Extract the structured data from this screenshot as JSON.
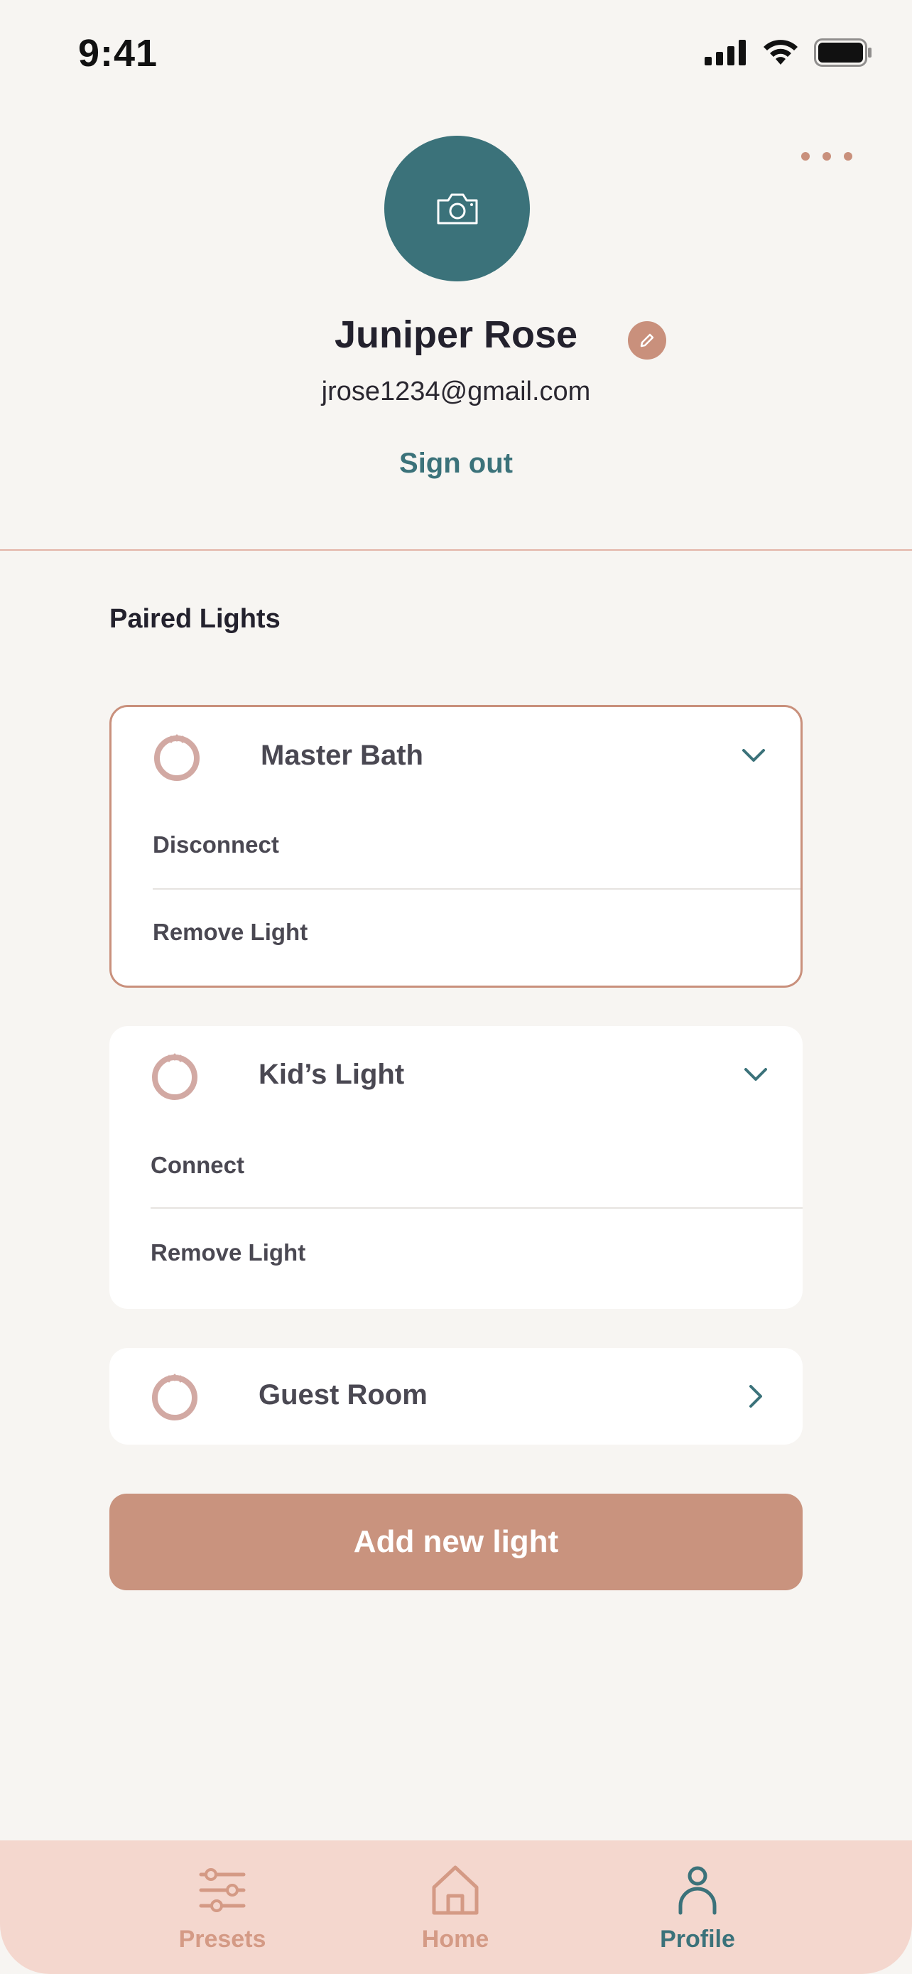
{
  "status_bar": {
    "time": "9:41"
  },
  "profile": {
    "name": "Juniper Rose",
    "email": "jrose1234@gmail.com",
    "sign_out_label": "Sign out"
  },
  "section": {
    "title": "Paired Lights"
  },
  "lights": [
    {
      "name": "Master Bath",
      "expanded": true,
      "actions": [
        "Disconnect",
        "Remove Light"
      ]
    },
    {
      "name": "Kid’s Light",
      "expanded": true,
      "actions": [
        "Connect",
        "Remove Light"
      ]
    },
    {
      "name": "Guest Room",
      "expanded": false,
      "actions": []
    }
  ],
  "add_button_label": "Add new light",
  "tabs": [
    {
      "label": "Presets",
      "icon": "sliders-icon",
      "active": false
    },
    {
      "label": "Home",
      "icon": "home-icon",
      "active": false
    },
    {
      "label": "Profile",
      "icon": "person-icon",
      "active": true
    }
  ],
  "colors": {
    "accent": "#c9907c",
    "primary": "#3b727a",
    "tab_bar": "#f4d7ce",
    "background": "#f7f5f2"
  }
}
